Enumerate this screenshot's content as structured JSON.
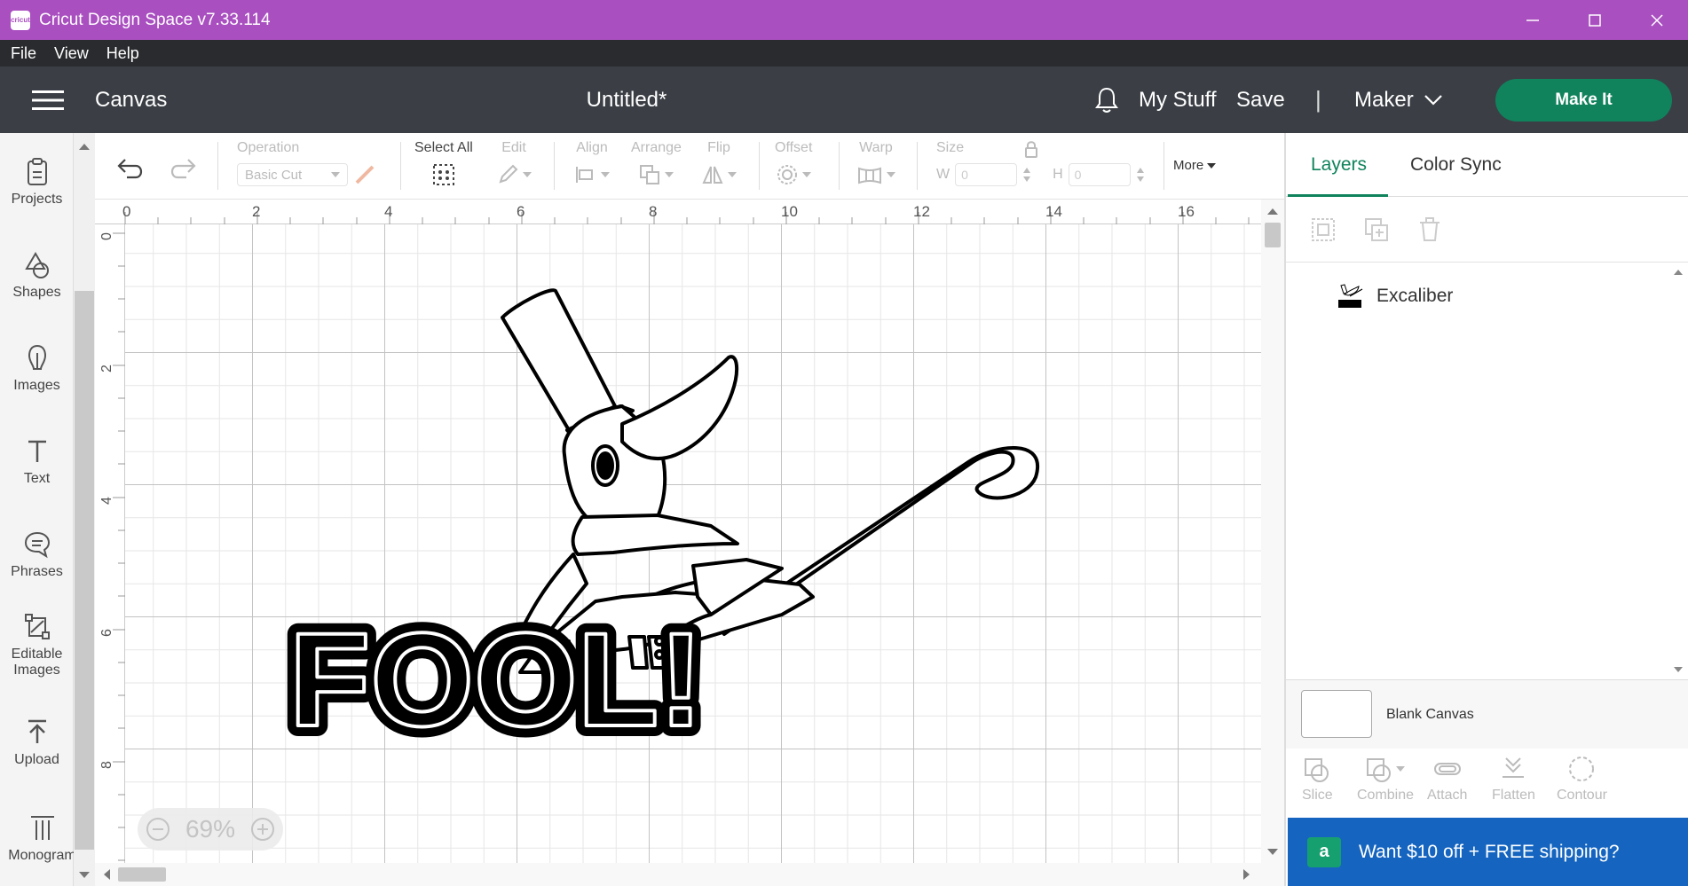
{
  "window": {
    "title": "Cricut Design Space  v7.33.114",
    "logo_text": "cricut"
  },
  "menubar": {
    "items": [
      "File",
      "View",
      "Help"
    ]
  },
  "header": {
    "section": "Canvas",
    "document_title": "Untitled*",
    "my_stuff": "My Stuff",
    "save": "Save",
    "separator": "|",
    "machine": "Maker",
    "make_it": "Make It"
  },
  "sidebar": {
    "items": [
      {
        "label": "Projects",
        "icon": "projects-icon"
      },
      {
        "label": "Shapes",
        "icon": "shapes-icon"
      },
      {
        "label": "Images",
        "icon": "images-icon"
      },
      {
        "label": "Text",
        "icon": "text-icon"
      },
      {
        "label": "Phrases",
        "icon": "phrases-icon"
      },
      {
        "label": "Editable Images",
        "icon": "editable-images-icon"
      },
      {
        "label": "Upload",
        "icon": "upload-icon"
      },
      {
        "label": "Monogram",
        "icon": "monogram-icon"
      }
    ]
  },
  "toolbar": {
    "operation_label": "Operation",
    "operation_value": "Basic Cut",
    "select_all": "Select All",
    "edit": "Edit",
    "align": "Align",
    "arrange": "Arrange",
    "flip": "Flip",
    "offset": "Offset",
    "warp": "Warp",
    "size": "Size",
    "w_label": "W",
    "w_value": "0",
    "h_label": "H",
    "h_value": "0",
    "more": "More"
  },
  "ruler": {
    "top_labels": [
      "0",
      "2",
      "4",
      "6",
      "8",
      "10",
      "12",
      "14",
      "16"
    ],
    "left_labels": [
      "0",
      "2",
      "4",
      "6",
      "8"
    ]
  },
  "canvas": {
    "artwork_text": "FOOL!"
  },
  "zoom": {
    "level": "69%"
  },
  "panel": {
    "tabs": [
      "Layers",
      "Color Sync"
    ],
    "active_tab": "Layers",
    "layers": [
      {
        "name": "Excaliber"
      }
    ],
    "blank_canvas": "Blank Canvas",
    "actions": [
      "Slice",
      "Combine",
      "Attach",
      "Flatten",
      "Contour"
    ]
  },
  "promo": {
    "badge": "a",
    "text": "Want $10 off + FREE shipping?"
  },
  "colors": {
    "titlebar": "#a94fc0",
    "header": "#3b3f45",
    "accent": "#10835c",
    "promo": "#1565c0"
  }
}
